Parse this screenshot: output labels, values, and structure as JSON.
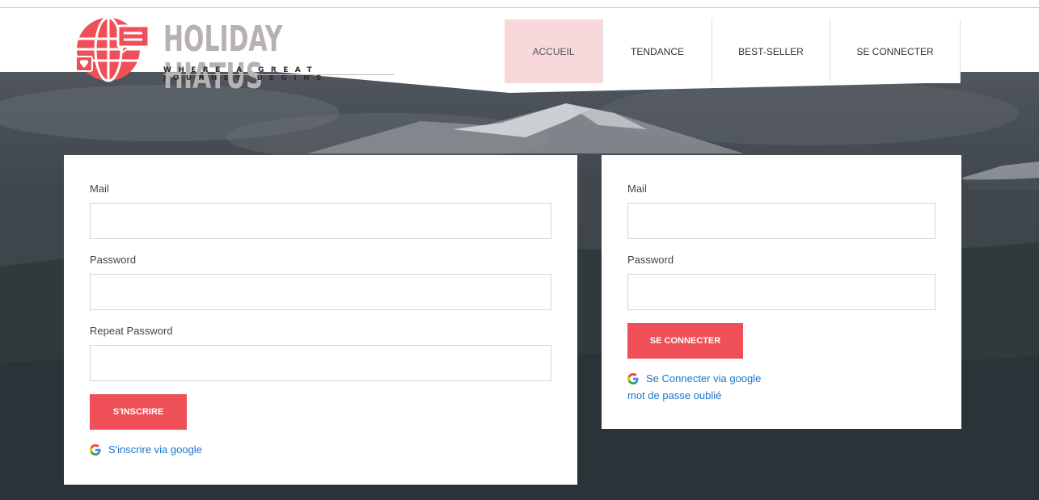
{
  "brand": {
    "name": "HOLIDAY HIATUS",
    "tagline": "WHERE A GREAT JOURNEY BEGINS",
    "logo_icon": "globe-chat-icon",
    "color": "#ef5058"
  },
  "nav": {
    "items": [
      {
        "label": "ACCUEIL",
        "active": true
      },
      {
        "label": "TENDANCE",
        "active": false
      },
      {
        "label": "BEST-SELLER",
        "active": false
      },
      {
        "label": "SE CONNECTER",
        "active": false
      }
    ],
    "active_color": "#f9d8dc"
  },
  "signup": {
    "mail_label": "Mail",
    "mail_value": "",
    "password_label": "Password",
    "password_value": "",
    "repeat_label": "Repeat Password",
    "repeat_value": "",
    "submit_label": "S'INSCRIRE",
    "google_label": "S'inscrire via google",
    "google_icon": "google-g-icon"
  },
  "login": {
    "mail_label": "Mail",
    "mail_value": "",
    "password_label": "Password",
    "password_value": "",
    "submit_label": "SE CONNECTER",
    "google_label": "Se Connecter via google",
    "google_icon": "google-g-icon",
    "forgot_label": "mot de passe oublié"
  },
  "colors": {
    "accent": "#ef5058",
    "link": "#1a73c9"
  }
}
